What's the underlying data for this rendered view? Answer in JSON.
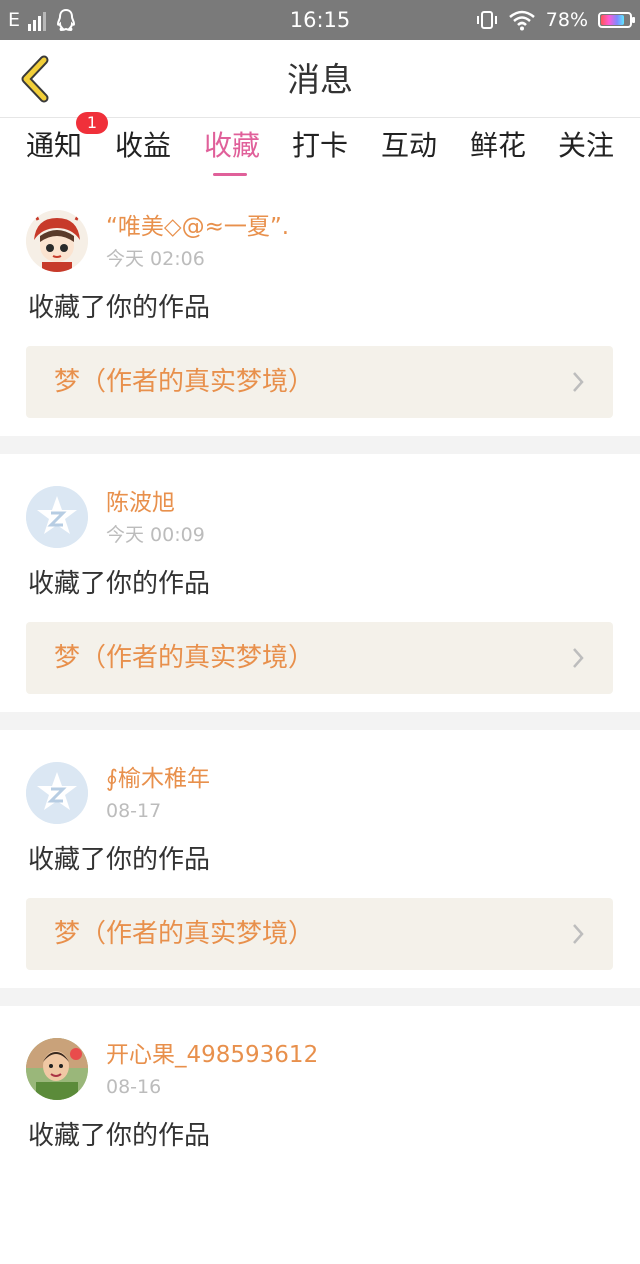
{
  "status_bar": {
    "network": "E",
    "time": "16:15",
    "battery_percent": "78%",
    "battery_level": 0.78
  },
  "header": {
    "title": "消息"
  },
  "tabs": [
    {
      "label": "通知",
      "badge": "1"
    },
    {
      "label": "收益"
    },
    {
      "label": "收藏",
      "active": true
    },
    {
      "label": "打卡"
    },
    {
      "label": "互动"
    },
    {
      "label": "鲜花"
    },
    {
      "label": "关注"
    }
  ],
  "messages": [
    {
      "username": "“唯美◇@≈一夏”.",
      "time": "今天 02:06",
      "action": "收藏了你的作品",
      "work_title": "梦（作者的真实梦境）"
    },
    {
      "username": "陈波旭",
      "time": "今天 00:09",
      "action": "收藏了你的作品",
      "work_title": "梦（作者的真实梦境）"
    },
    {
      "username": "∮榆木稚年",
      "time": "08-17",
      "action": "收藏了你的作品",
      "work_title": "梦（作者的真实梦境）"
    },
    {
      "username": "开心果_498593612",
      "time": "08-16",
      "action": "收藏了你的作品"
    }
  ],
  "colors": {
    "accent": "#e0609a",
    "username": "#e8904c",
    "badge": "#f0303a",
    "card_bg": "#f4f1ea"
  }
}
